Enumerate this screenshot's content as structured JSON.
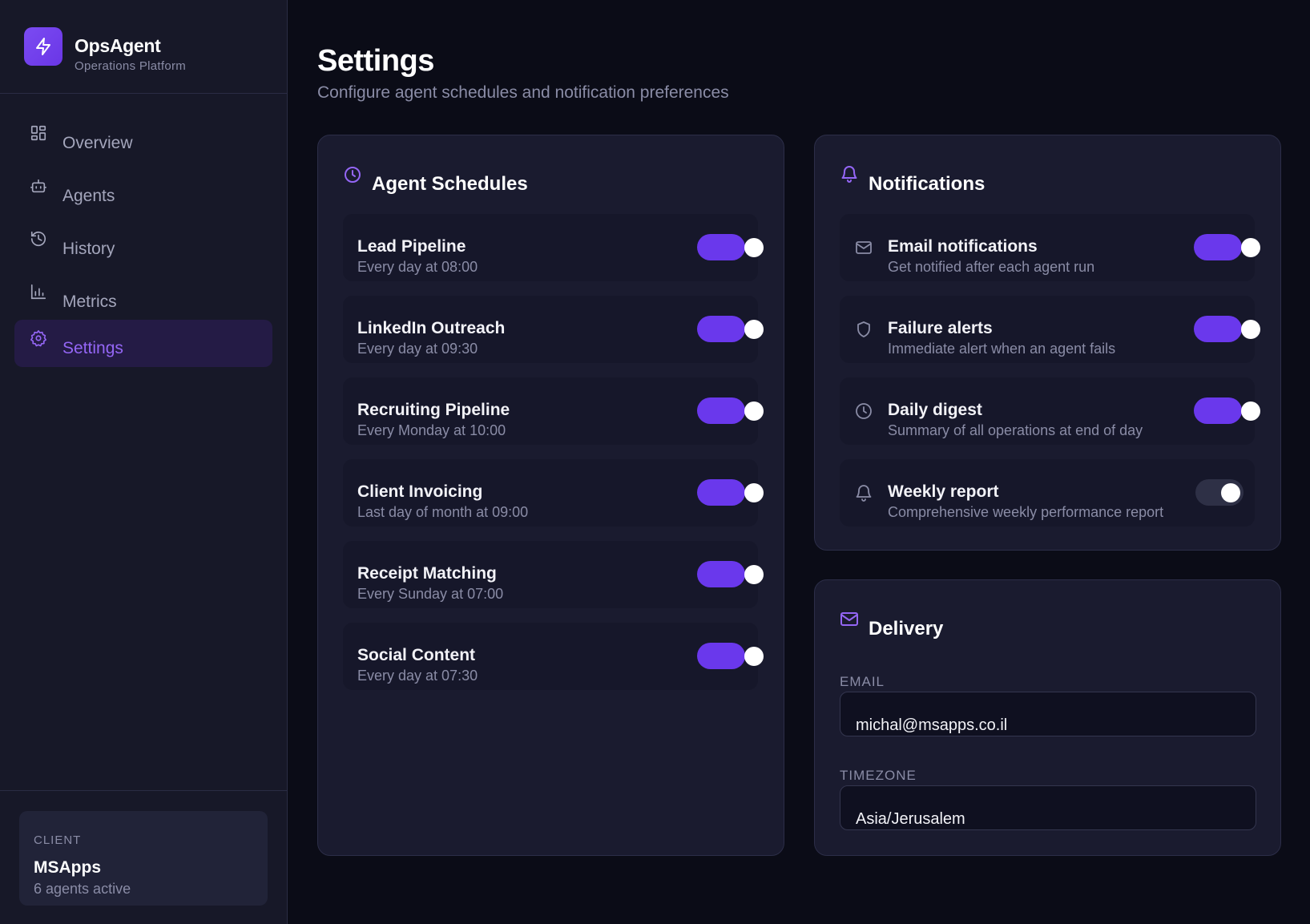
{
  "brand": {
    "name": "OpsAgent",
    "subtitle": "Operations Platform"
  },
  "nav": [
    {
      "label": "Overview",
      "icon": "grid-icon"
    },
    {
      "label": "Agents",
      "icon": "bot-icon"
    },
    {
      "label": "History",
      "icon": "history-icon"
    },
    {
      "label": "Metrics",
      "icon": "bar-chart-icon"
    },
    {
      "label": "Settings",
      "icon": "gear-icon",
      "active": true
    }
  ],
  "client": {
    "label": "CLIENT",
    "name": "MSApps",
    "status": "6 agents active"
  },
  "page": {
    "title": "Settings",
    "subtitle": "Configure agent schedules and notification preferences"
  },
  "schedules": {
    "title": "Agent Schedules",
    "items": [
      {
        "name": "Lead Pipeline",
        "schedule": "Every day at 08:00",
        "enabled": true
      },
      {
        "name": "LinkedIn Outreach",
        "schedule": "Every day at 09:30",
        "enabled": true
      },
      {
        "name": "Recruiting Pipeline",
        "schedule": "Every Monday at 10:00",
        "enabled": true
      },
      {
        "name": "Client Invoicing",
        "schedule": "Last day of month at 09:00",
        "enabled": true
      },
      {
        "name": "Receipt Matching",
        "schedule": "Every Sunday at 07:00",
        "enabled": true
      },
      {
        "name": "Social Content",
        "schedule": "Every day at 07:30",
        "enabled": true
      }
    ]
  },
  "notifications": {
    "title": "Notifications",
    "items": [
      {
        "name": "Email notifications",
        "description": "Get notified after each agent run",
        "icon": "mail-icon",
        "enabled": true
      },
      {
        "name": "Failure alerts",
        "description": "Immediate alert when an agent fails",
        "icon": "shield-icon",
        "enabled": true
      },
      {
        "name": "Daily digest",
        "description": "Summary of all operations at end of day",
        "icon": "clock-icon",
        "enabled": true
      },
      {
        "name": "Weekly report",
        "description": "Comprehensive weekly performance report",
        "icon": "bell-icon",
        "enabled": false
      }
    ]
  },
  "delivery": {
    "title": "Delivery",
    "email_label": "EMAIL",
    "email_value": "michal@msapps.co.il",
    "timezone_label": "TIMEZONE",
    "timezone_value": "Asia/Jerusalem"
  },
  "colors": {
    "accent": "#6a38ec",
    "accent_text": "#9466f5",
    "background": "#0b0c17",
    "panel": "#1a1b2f"
  }
}
